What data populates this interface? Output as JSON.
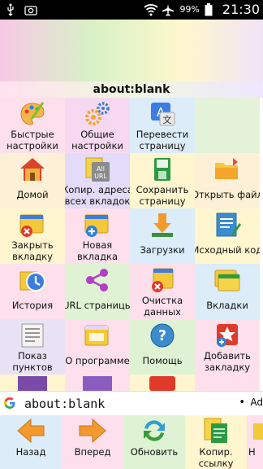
{
  "status_bar": {
    "time": "21:30",
    "battery": "99%",
    "icons": [
      "usb-icon",
      "camera-icon",
      "wifi-icon",
      "airplane-icon",
      "battery-icon"
    ]
  },
  "page": {
    "title": "about:blank"
  },
  "menu": {
    "items": [
      {
        "label": "Быстрые\nнастройки",
        "icon": "palette-icon"
      },
      {
        "label": "Общие\nнастройки",
        "icon": "gears-icon"
      },
      {
        "label": "Перевести\nстраницу",
        "icon": "translate-icon"
      },
      {
        "label": "",
        "icon": ""
      },
      {
        "label": "Домой",
        "icon": "home-icon"
      },
      {
        "label": "Копир. адреса\nвсех вкладок",
        "icon": "copy-urls-icon"
      },
      {
        "label": "Сохранить\nстраницу",
        "icon": "save-page-icon"
      },
      {
        "label": "Открыть файл",
        "icon": "open-folder-icon"
      },
      {
        "label": "Закрыть\nвкладку",
        "icon": "close-tab-icon"
      },
      {
        "label": "Новая\nвкладка",
        "icon": "new-tab-icon"
      },
      {
        "label": "Загрузки",
        "icon": "download-icon"
      },
      {
        "label": "Исходный код",
        "icon": "source-code-icon"
      },
      {
        "label": "История",
        "icon": "history-icon"
      },
      {
        "label": "URL страницы",
        "icon": "share-icon"
      },
      {
        "label": "Очистка\nданных",
        "icon": "clear-data-icon"
      },
      {
        "label": "Вкладки",
        "icon": "tabs-icon"
      },
      {
        "label": "Показ\nпунктов",
        "icon": "show-items-icon"
      },
      {
        "label": "О программе",
        "icon": "about-icon"
      },
      {
        "label": "Помощь",
        "icon": "help-icon"
      },
      {
        "label": "Добавить\nзакладку",
        "icon": "add-bookmark-icon"
      }
    ]
  },
  "address_bar": {
    "value": "about:blank",
    "engine_letter": "G",
    "add_label": "Ad"
  },
  "bottom_toolbar": {
    "items": [
      {
        "label": "Назад",
        "icon": "back-arrow-icon"
      },
      {
        "label": "Вперед",
        "icon": "forward-arrow-icon"
      },
      {
        "label": "Обновить",
        "icon": "refresh-icon"
      },
      {
        "label": "Копир.\nссылку",
        "icon": "copy-link-icon"
      },
      {
        "label": "Н",
        "icon": "next-icon"
      }
    ]
  },
  "colors": {
    "status_bar_bg": "#000000",
    "accent_blue": "#2f7fd6",
    "folder_yellow": "#f5c83a",
    "arrow_orange": "#f29a2e",
    "cell_pink": "#fde0ec",
    "cell_green": "#dff3d4",
    "cell_yellow": "#fff5cf",
    "cell_blue": "#dcecf8",
    "cell_lavender": "#ece3fb"
  }
}
